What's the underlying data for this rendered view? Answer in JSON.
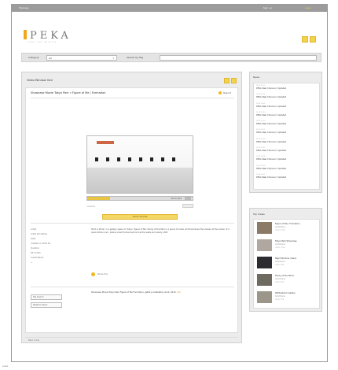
{
  "topbar": {
    "left_text": "Toppage",
    "right_text_1": "Sign up",
    "right_text_2": "Login"
  },
  "logo": {
    "text": "PEKA",
    "subtitle": "VIDEO ART ARCHIVE"
  },
  "search": {
    "category_label": "Category",
    "category_value": "All",
    "keyword_label": "Search by Tag"
  },
  "main": {
    "title": "Video Window Gen",
    "breadcrumb": "Showcase Movie   Tokyo Park   «   Figure of Me / Formation",
    "report_label": "Report",
    "player": {
      "time": "02:13  1/14"
    },
    "controls_label": "volume",
    "download_label": "Add to favorite",
    "fields": [
      "Artist",
      "Artist Info Name",
      "Date",
      "Created in 2010 04",
      "Duration",
      "02:13 Min",
      "Credit Name",
      "+"
    ],
    "description": "Shot in 2012, in a gallery space in Tokyo. Figure of Me: Study of the Mirror. A piece of video art that places the viewer at the center of a quiet white room, where small framed works line the walls and slowly shift.",
    "share_label": "Share this",
    "boxes": [
      "Tag Search",
      "Related videos"
    ],
    "jp_text": "Showcase Movie Tokyo Park Figure of Me Formation, gallery installation work, 2012.",
    "jp_link": "link",
    "footer": "Back to top"
  },
  "news": {
    "title": "News",
    "items": [
      {
        "date": "2012.12.12",
        "text": "PEKA Web Channel / Updated"
      },
      {
        "date": "2012.12.10",
        "text": "PEKA Web Channel / Updated"
      },
      {
        "date": "2012.12.05",
        "text": "PEKA Web Channel / Updated"
      },
      {
        "date": "2012.11.30",
        "text": "PEKA Web Channel / Updated"
      },
      {
        "date": "2012.11.22",
        "text": "PEKA Web Channel / Updated"
      },
      {
        "date": "2012.11.15",
        "text": "PEKA Web Channel / Updated"
      },
      {
        "date": "2012.11.08",
        "text": "PEKA Web Channel / Updated"
      },
      {
        "date": "2012.11.01",
        "text": "PEKA Web Channel / Updated"
      },
      {
        "date": "2012.10.25",
        "text": "PEKA Web Channel / Updated"
      },
      {
        "date": "2012.10.18",
        "text": "PEKA Web Channel / Updated"
      },
      {
        "date": "2012.10.11",
        "text": "PEKA Web Channel / Updated"
      }
    ]
  },
  "ranking": {
    "title": "Top Views",
    "items": [
      {
        "title": "Figure of Me / Formation",
        "artist": "Artist Name",
        "views": "Views 1234",
        "color": "#8a7a66"
      },
      {
        "title": "Tokyo Park Showcase",
        "artist": "Artist Name",
        "views": "Views 1120",
        "color": "#b0a8a0"
      },
      {
        "title": "Night Window / Neon",
        "artist": "Artist Name",
        "views": "Views 980",
        "color": "#2b2b30"
      },
      {
        "title": "Study of the Mirror",
        "artist": "Artist Name",
        "views": "Views 870",
        "color": "#6e6a60"
      },
      {
        "title": "White Room Gallery",
        "artist": "Artist Name",
        "views": "Views 760",
        "color": "#9c968a"
      }
    ]
  },
  "bottom_left": "peka"
}
